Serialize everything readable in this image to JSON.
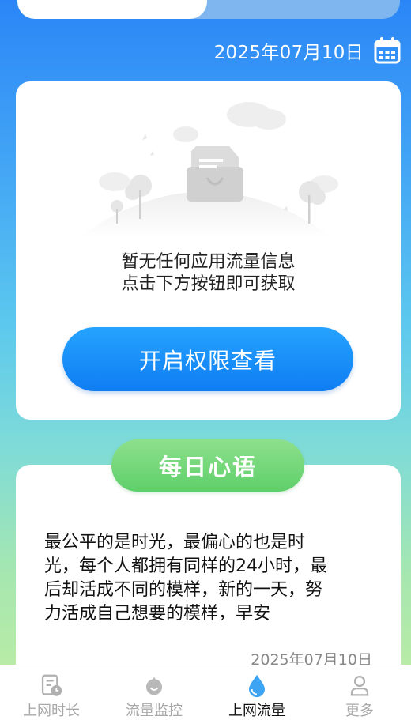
{
  "header": {
    "date": "2025年07月10日",
    "calendar_icon": "calendar-icon"
  },
  "empty_state": {
    "line1": "暂无任何应用流量信息",
    "line2": "点击下方按钮即可获取",
    "button_label": "开启权限查看",
    "illustration_icon": "empty-inbox-illustration"
  },
  "daily": {
    "title": "每日心语",
    "quote_lines": [
      "最公平的是时光，最偏心的也是时",
      "光，每个人都拥有同样的24小时，最",
      "后却活成不同的模样，新的一天，努",
      "力活成自己想要的模样，早安"
    ],
    "date": "2025年07月10日"
  },
  "nav": {
    "items": [
      {
        "label": "上网时长",
        "icon": "screen-time-icon",
        "active": false
      },
      {
        "label": "流量监控",
        "icon": "traffic-monitor-icon",
        "active": false
      },
      {
        "label": "上网流量",
        "icon": "water-drop-icon",
        "active": true
      },
      {
        "label": "更多",
        "icon": "person-icon",
        "active": false
      }
    ]
  },
  "colors": {
    "accent_blue": "#1a8cf5",
    "green": "#66d272",
    "inactive_gray": "#a8a8a8"
  }
}
